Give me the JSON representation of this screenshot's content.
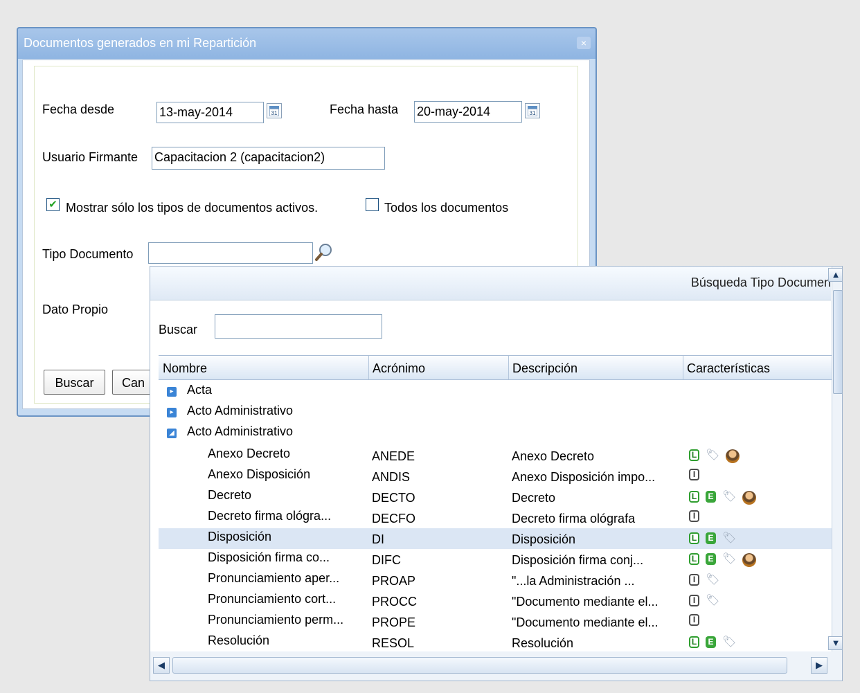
{
  "window": {
    "title": "Documentos generados en mi Repartición",
    "close_glyph": "×"
  },
  "form": {
    "fecha_desde_label": "Fecha desde",
    "fecha_desde_value": "13-may-2014",
    "fecha_hasta_label": "Fecha hasta",
    "fecha_hasta_value": "20-may-2014",
    "usuario_label": "Usuario Firmante",
    "usuario_value": "Capacitacion 2  (capacitacion2)",
    "check_activos_label": "Mostrar sólo los tipos de documentos activos.",
    "check_activos_checked": true,
    "check_todos_label": "Todos los documentos",
    "check_todos_checked": false,
    "tipo_label": "Tipo Documento",
    "tipo_value": "",
    "dato_propio_label": "Dato Propio",
    "buscar_button": "Buscar",
    "cancelar_button": "Can"
  },
  "popup": {
    "title": "Búsqueda Tipo Documen",
    "buscar_label": "Buscar",
    "buscar_value": "",
    "columns": [
      "Nombre",
      "Acrónimo",
      "Descripción",
      "Características"
    ],
    "groups": [
      {
        "label": "Acta",
        "expanded": false
      },
      {
        "label": "Acto Administrativo",
        "expanded": false
      },
      {
        "label": "Acto Administrativo",
        "expanded": true
      }
    ],
    "rows": [
      {
        "nombre": "Anexo Decreto",
        "acronimo": "ANEDE",
        "descripcion": "Anexo Decreto",
        "icons": [
          "L",
          "tag",
          "user"
        ],
        "selected": false
      },
      {
        "nombre": "Anexo Disposición",
        "acronimo": "ANDIS",
        "descripcion": "Anexo Disposición impo...",
        "icons": [
          "I"
        ],
        "selected": false
      },
      {
        "nombre": "Decreto",
        "acronimo": "DECTO",
        "descripcion": "Decreto",
        "icons": [
          "L",
          "E",
          "tag",
          "user"
        ],
        "selected": false
      },
      {
        "nombre": "Decreto firma ológra...",
        "acronimo": "DECFO",
        "descripcion": "Decreto firma ológrafa",
        "icons": [
          "I"
        ],
        "selected": false
      },
      {
        "nombre": "Disposición",
        "acronimo": "DI",
        "descripcion": "Disposición",
        "icons": [
          "L",
          "E",
          "tag"
        ],
        "selected": true
      },
      {
        "nombre": "Disposición firma co...",
        "acronimo": "DIFC",
        "descripcion": "Disposición firma conj...",
        "icons": [
          "L",
          "E",
          "tag",
          "user"
        ],
        "selected": false
      },
      {
        "nombre": "Pronunciamiento aper...",
        "acronimo": "PROAP",
        "descripcion": "\"...la Administración ...",
        "icons": [
          "I",
          "tag"
        ],
        "selected": false
      },
      {
        "nombre": "Pronunciamiento cort...",
        "acronimo": "PROCC",
        "descripcion": "\"Documento mediante el...",
        "icons": [
          "I",
          "tag"
        ],
        "selected": false
      },
      {
        "nombre": "Pronunciamiento perm...",
        "acronimo": "PROPE",
        "descripcion": "\"Documento mediante el...",
        "icons": [
          "I"
        ],
        "selected": false
      },
      {
        "nombre": "Resolución",
        "acronimo": "RESOL",
        "descripcion": "Resolución",
        "icons": [
          "L",
          "E",
          "tag"
        ],
        "selected": false
      }
    ]
  },
  "colors": {
    "window_border": "#6b94c4",
    "selected_row": "#dbe6f4",
    "check_green": "#21a121"
  }
}
